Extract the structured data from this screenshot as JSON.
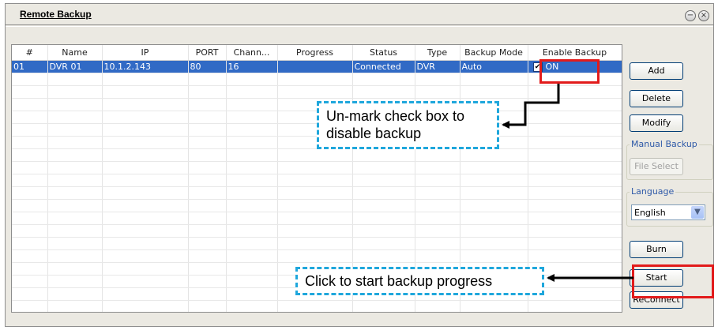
{
  "window": {
    "title": "Remote Backup"
  },
  "table": {
    "headers": [
      "#",
      "Name",
      "IP",
      "PORT",
      "Chann...",
      "Progress",
      "Status",
      "Type",
      "Backup Mode",
      "Enable Backup"
    ],
    "rows": [
      {
        "num": "01",
        "name": "DVR 01",
        "ip": "10.1.2.143",
        "port": "80",
        "channels": "16",
        "progress": "",
        "status": "Connected",
        "type": "DVR",
        "mode": "Auto",
        "enable_checked": true,
        "enable_label": "ON"
      }
    ]
  },
  "buttons": {
    "add": "Add",
    "delete": "Delete",
    "modify": "Modify",
    "file_select": "File Select",
    "burn": "Burn",
    "start": "Start",
    "reconnect": "ReConnect"
  },
  "groups": {
    "manual_backup": "Manual Backup",
    "language": "Language"
  },
  "language": {
    "selected": "English"
  },
  "callouts": {
    "uncheck": [
      "Un-mark check box to",
      "disable backup"
    ],
    "start": "Click to start backup progress"
  },
  "colors": {
    "selection": "#316ac5",
    "highlight": "#e21b1b",
    "callout_border": "#1fa7dc"
  },
  "icons": {
    "minimize": "minimize-icon",
    "close": "close-icon",
    "dropdown": "chevron-down-icon",
    "check": "checkmark-icon"
  }
}
